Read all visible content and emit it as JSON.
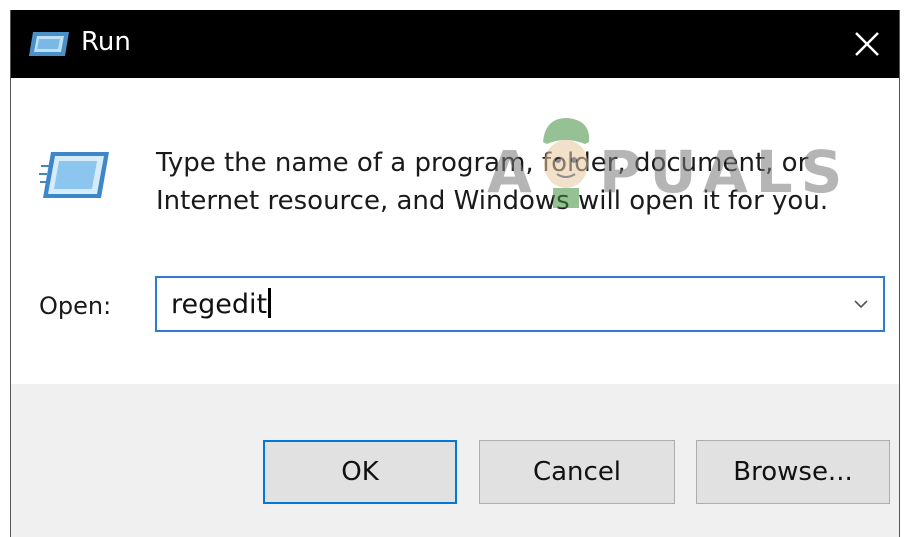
{
  "window": {
    "title": "Run",
    "icons": {
      "title_icon": "run-icon",
      "close_icon": "close-icon",
      "dialog_icon": "run-icon"
    }
  },
  "dialog": {
    "description_line1": "Type the name of a program, folder, document, or",
    "description_line2": "Internet resource, and Windows will open it for you.",
    "open_label": "Open:",
    "open_value": "regedit"
  },
  "buttons": {
    "ok": "OK",
    "cancel": "Cancel",
    "browse": "Browse..."
  },
  "watermark": {
    "text_left": "A",
    "text_right": "PUALS"
  },
  "colors": {
    "titlebar": "#000000",
    "focus_border": "#0078d7",
    "dialog_background": "#f0f0f0"
  }
}
